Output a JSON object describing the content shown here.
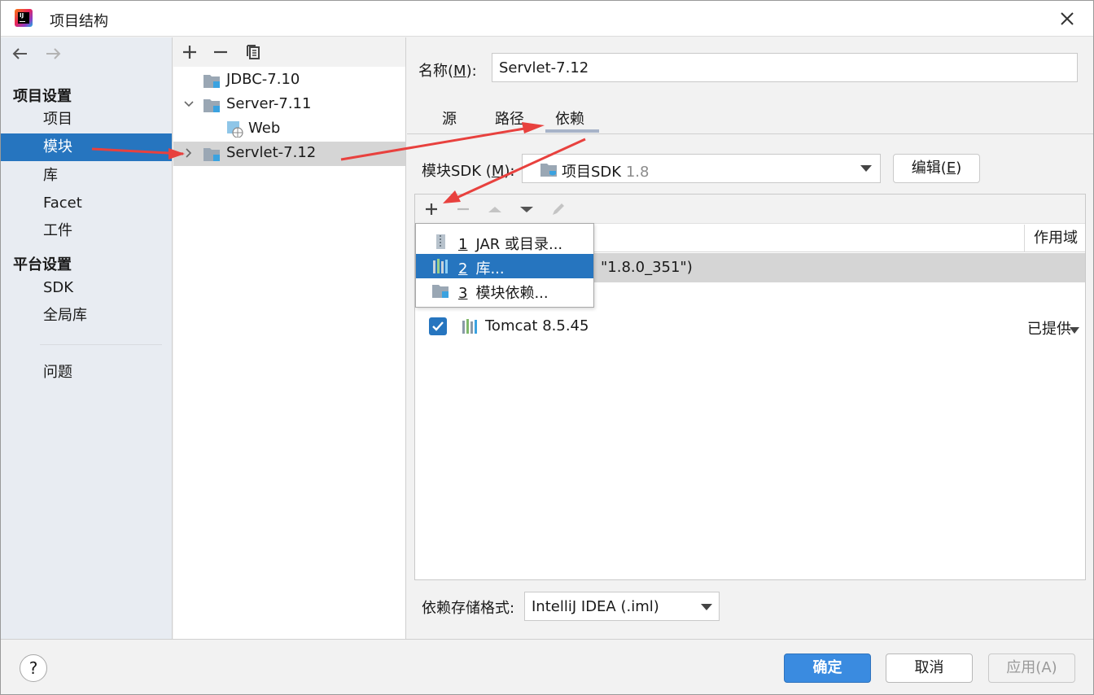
{
  "window": {
    "title": "项目结构",
    "close_icon": "close-icon"
  },
  "nav": {
    "section_project": "项目设置",
    "section_platform": "平台设置",
    "items": [
      {
        "label": "项目",
        "selected": false
      },
      {
        "label": "模块",
        "selected": true
      },
      {
        "label": "库",
        "selected": false
      },
      {
        "label": "Facet",
        "selected": false
      },
      {
        "label": "工件",
        "selected": false
      },
      {
        "label": "SDK",
        "selected": false
      },
      {
        "label": "全局库",
        "selected": false
      },
      {
        "label": "问题",
        "selected": false
      }
    ]
  },
  "tree": {
    "items": [
      {
        "label": "JDBC-7.10"
      },
      {
        "label": "Server-7.11",
        "expanded": true
      },
      {
        "label": "Web"
      },
      {
        "label": "Servlet-7.12",
        "selected": true
      }
    ]
  },
  "module": {
    "name_label": "名称",
    "name_mnemonic": "M",
    "name_value": "Servlet-7.12",
    "tabs": [
      {
        "label": "源"
      },
      {
        "label": "路径"
      },
      {
        "label": "依赖",
        "active": true
      }
    ],
    "sdk_label": "模块SDK (",
    "sdk_mnemonic": "M",
    "sdk_label_end": "):",
    "sdk_value": "项目SDK",
    "sdk_version": "1.8",
    "edit_label": "编辑(",
    "edit_mnemonic": "E",
    "edit_label_end": ")"
  },
  "dependencies": {
    "scope_header": "作用域",
    "rows": [
      {
        "text": "\"1.8.0_351\")",
        "selected": true
      },
      {
        "text": "Tomcat 8.5.45",
        "checked": true,
        "scope": "已提供"
      }
    ]
  },
  "popup_menu": {
    "items": [
      {
        "key": "1",
        "label": "JAR 或目录...",
        "icon": "jar-icon"
      },
      {
        "key": "2",
        "label": "库...",
        "icon": "library-icon",
        "highlighted": true
      },
      {
        "key": "3",
        "label": "模块依赖...",
        "icon": "module-icon"
      }
    ]
  },
  "storage": {
    "label": "依赖存储格式:",
    "value": "IntelliJ IDEA (.iml)"
  },
  "buttons": {
    "help": "?",
    "ok": "确定",
    "cancel": "取消",
    "apply": "应用(A)"
  },
  "colors": {
    "accent": "#2675bf",
    "annotation_arrow": "#e8413e"
  }
}
